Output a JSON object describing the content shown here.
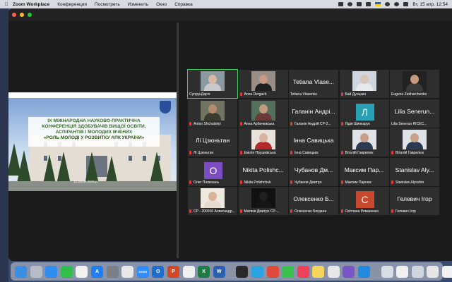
{
  "menubar": {
    "app_name": "Zoom Workplace",
    "items": [
      "Конференция",
      "Посмотреть",
      "Изменить",
      "Окно",
      "Справка"
    ],
    "datetime": "Вт, 15 апр.  12:54"
  },
  "slide": {
    "line1": "IX МІЖНАРОДНА НАУКОВО-ПРАКТИЧНА",
    "line2": "КОНФЕРЕНЦІЯ ЗДОБУВАЧІВ ВИЩОЇ ОСВІТИ,",
    "line3": "АСПІРАНТІВ І МОЛОДИХ ВЧЕНИХ",
    "line4": "«РОЛЬ МОЛОДІ У РОЗВИТКУ АПК УКРАЇНИ»",
    "date": "15 квітня 2025 р."
  },
  "participants": [
    {
      "big": "",
      "name": "СупрунДар'я",
      "muted": false,
      "kind": "photo",
      "skin": "#d9b8a4",
      "cloth": "#c9c9c9",
      "bg": "#8a9aa0",
      "active": true
    },
    {
      "big": "",
      "name": "Anna Dergach",
      "muted": true,
      "kind": "photo",
      "skin": "#c79a86",
      "cloth": "#1f1f1f",
      "bg": "#9a8d86",
      "active": false
    },
    {
      "big": "Tetiana Vlase...",
      "name": "Tetiana Vlasenko",
      "muted": false,
      "kind": "text",
      "active": false
    },
    {
      "big": "",
      "name": "Бай Дунцзин",
      "muted": true,
      "kind": "photo",
      "skin": "#d6c6b8",
      "cloth": "#e7e9ee",
      "bg": "#cfd6de",
      "active": false
    },
    {
      "big": "",
      "name": "Eugene Zakharchenko",
      "muted": false,
      "kind": "photo",
      "skin": "#c89a7d",
      "cloth": "#3a3a3a",
      "bg": "#222222",
      "active": false
    },
    {
      "big": "",
      "name": "Anton Shchutskyi",
      "muted": true,
      "kind": "photo",
      "skin": "#b48a6d",
      "cloth": "#3a3a30",
      "bg": "#707460",
      "active": false
    },
    {
      "big": "",
      "name": "Анна Арбачевська",
      "muted": true,
      "kind": "photo",
      "skin": "#c49a82",
      "cloth": "#6a3a3a",
      "bg": "#55705a",
      "active": false
    },
    {
      "big": "Галанін Андрі...",
      "name": "Галанін Андрій СР-2...",
      "muted": true,
      "kind": "text",
      "active": false
    },
    {
      "big": "Л",
      "name": "Лідія Шинкарук",
      "muted": true,
      "kind": "avatar",
      "color": "#2aa0b5",
      "active": false
    },
    {
      "big": "Lilia Senerun...",
      "name": "Lilia Senerun RICEC...",
      "muted": false,
      "kind": "text",
      "active": false
    },
    {
      "big": "Лі Цзюньтан",
      "name": "Лі Цзюньтан",
      "muted": true,
      "kind": "text",
      "active": false
    },
    {
      "big": "",
      "name": "Емілія Прушківська",
      "muted": true,
      "kind": "photo",
      "skin": "#d8b4a0",
      "cloth": "#b32a2a",
      "bg": "#e8e2da",
      "active": false
    },
    {
      "big": "Інна Савицька",
      "name": "Інна Савицька",
      "muted": true,
      "kind": "text",
      "active": false
    },
    {
      "big": "",
      "name": "Віталій Гаврилюк",
      "muted": true,
      "kind": "photo",
      "skin": "#c9a08a",
      "cloth": "#2d3b52",
      "bg": "#dfe3e8",
      "active": false
    },
    {
      "big": "",
      "name": "Віталій Гаврилюк",
      "muted": true,
      "kind": "photo",
      "skin": "#c9a08a",
      "cloth": "#2d3b52",
      "bg": "#dfe3e8",
      "active": false
    },
    {
      "big": "О",
      "name": "Олег Полюхань",
      "muted": true,
      "kind": "avatar",
      "color": "#7b4cc2",
      "active": false
    },
    {
      "big": "Nikita Polishc...",
      "name": "Nikita Polishchuk",
      "muted": true,
      "kind": "text",
      "active": false
    },
    {
      "big": "Чубанов Дм...",
      "name": "Чубанов Дмитро",
      "muted": true,
      "kind": "text",
      "active": false
    },
    {
      "big": "Максим Пар...",
      "name": "Максим Парнюк",
      "muted": true,
      "kind": "text",
      "active": false
    },
    {
      "big": "Stanislav Aly...",
      "name": "Stanislav Alyoshin",
      "muted": true,
      "kind": "text",
      "active": false
    },
    {
      "big": "",
      "name": "СР - 200016 Александр...",
      "muted": true,
      "kind": "photo",
      "skin": "#d9b39a",
      "cloth": "#e6ddd0",
      "bg": "#efe9e0",
      "active": false
    },
    {
      "big": "",
      "name": "Матвєв Дмитро СР-...",
      "muted": true,
      "kind": "photo",
      "skin": "#1f1f1f",
      "cloth": "#151515",
      "bg": "#111111",
      "active": false
    },
    {
      "big": "Олексенко Б...",
      "name": "Олексенко Богдана",
      "muted": true,
      "kind": "text",
      "active": false
    },
    {
      "big": "С",
      "name": "Світлана Романенко",
      "muted": true,
      "kind": "avatar",
      "color": "#c9492e",
      "active": false
    },
    {
      "big": "Гелевич Ігор",
      "name": "Гелевич Ігор",
      "muted": true,
      "kind": "text",
      "active": false
    }
  ],
  "dock": [
    {
      "icon": "finder-icon",
      "color": "#3a8ee6",
      "glyph": ""
    },
    {
      "icon": "launchpad-icon",
      "color": "#b7bcc8",
      "glyph": ""
    },
    {
      "icon": "safari-icon",
      "color": "#2f8ef0",
      "glyph": ""
    },
    {
      "icon": "facetime-icon",
      "color": "#2fbf4a",
      "glyph": ""
    },
    {
      "icon": "calendar-icon",
      "color": "#f2f2f2",
      "glyph": ""
    },
    {
      "icon": "appstore-icon",
      "color": "#1f7ef0",
      "glyph": "A"
    },
    {
      "icon": "settings-icon",
      "color": "#7d7f86",
      "glyph": ""
    },
    {
      "icon": "chrome-icon",
      "color": "#e8e8e8",
      "glyph": ""
    },
    {
      "icon": "zoom-icon",
      "color": "#2d8cff",
      "glyph": "zoom"
    },
    {
      "icon": "outlook-icon",
      "color": "#1c6fd1",
      "glyph": "O"
    },
    {
      "icon": "powerpoint-icon",
      "color": "#d24726",
      "glyph": "P"
    },
    {
      "icon": "photos-icon",
      "color": "#f0f0f0",
      "glyph": ""
    },
    {
      "icon": "excel-icon",
      "color": "#1d7a45",
      "glyph": "X"
    },
    {
      "icon": "word-icon",
      "color": "#2b5fb4",
      "glyph": "W"
    },
    {
      "icon": "terminal-icon",
      "color": "#2a2a2a",
      "glyph": ""
    },
    {
      "icon": "telegram-icon",
      "color": "#2aa3e0",
      "glyph": ""
    },
    {
      "icon": "browser-icon",
      "color": "#e04a3a",
      "glyph": ""
    },
    {
      "icon": "messages-icon",
      "color": "#3ac24c",
      "glyph": ""
    },
    {
      "icon": "music-icon",
      "color": "#f0405a",
      "glyph": ""
    },
    {
      "icon": "notes-icon",
      "color": "#f5d65a",
      "glyph": ""
    },
    {
      "icon": "bars-icon",
      "color": "#e8e8e8",
      "glyph": ""
    },
    {
      "icon": "viber-icon",
      "color": "#7a55c8",
      "glyph": ""
    },
    {
      "icon": "keynote-icon",
      "color": "#1f8ae0",
      "glyph": ""
    },
    {
      "icon": "finder-window-icon",
      "color": "#d8dde6",
      "glyph": ""
    },
    {
      "icon": "document-icon",
      "color": "#f0f0f0",
      "glyph": ""
    },
    {
      "icon": "preview-icon",
      "color": "#cfd6e0",
      "glyph": ""
    },
    {
      "icon": "archive-icon",
      "color": "#e6e6e6",
      "glyph": ""
    },
    {
      "icon": "file-icon",
      "color": "#f2f2f2",
      "glyph": ""
    },
    {
      "icon": "trash-icon",
      "color": "#c8cdd6",
      "glyph": ""
    }
  ]
}
